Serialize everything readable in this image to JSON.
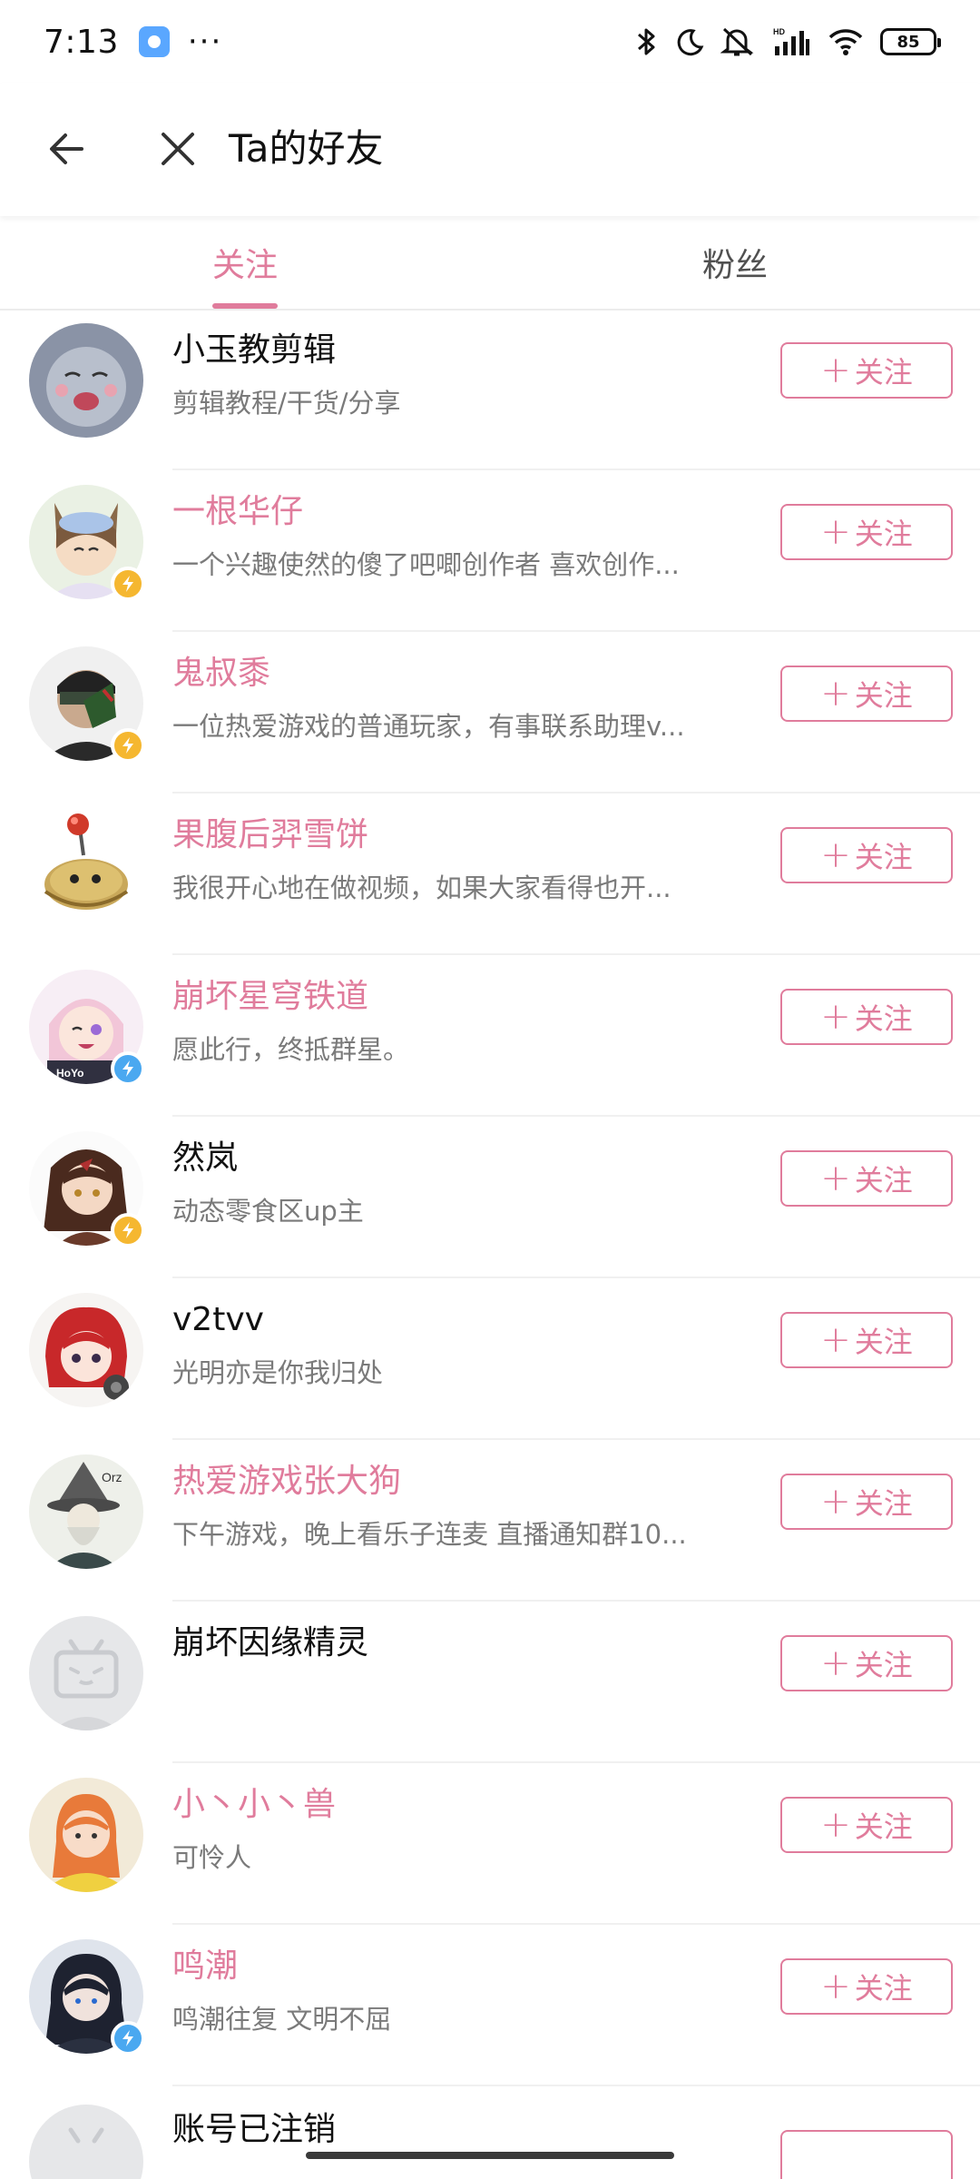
{
  "status_bar": {
    "time": "7:13",
    "more": "···",
    "battery": "85"
  },
  "header": {
    "title": "Ta的好友"
  },
  "tabs": [
    {
      "label": "关注",
      "active": true
    },
    {
      "label": "粉丝",
      "active": false
    }
  ],
  "follow_label": "关注",
  "users": [
    {
      "name": "小玉教剪辑",
      "desc": "剪辑教程/干货/分享",
      "vip": false,
      "badge": null
    },
    {
      "name": "一根华仔",
      "desc": "一个兴趣使然的傻了吧唧创作者 喜欢创作...",
      "vip": true,
      "badge": "yellow"
    },
    {
      "name": "鬼叔黍",
      "desc": "一位热爱游戏的普通玩家，有事联系助理v...",
      "vip": true,
      "badge": "yellow"
    },
    {
      "name": "果腹后羿雪饼",
      "desc": "我很开心地在做视频，如果大家看得也开...",
      "vip": true,
      "badge": null
    },
    {
      "name": "崩坏星穹铁道",
      "desc": "愿此行，终抵群星。",
      "vip": true,
      "badge": "blue"
    },
    {
      "name": "然岚",
      "desc": "动态零食区up主",
      "vip": false,
      "badge": "yellow"
    },
    {
      "name": "v2tvv",
      "desc": "光明亦是你我归处",
      "vip": false,
      "badge": null
    },
    {
      "name": "热爱游戏张大狗",
      "desc": "下午游戏，晚上看乐子连麦 直播通知群10...",
      "vip": true,
      "badge": null
    },
    {
      "name": "崩坏因缘精灵",
      "desc": "",
      "vip": false,
      "badge": null
    },
    {
      "name": "小丶小丶兽",
      "desc": "可怜人",
      "vip": true,
      "badge": null
    },
    {
      "name": "鸣潮",
      "desc": "鸣潮往复 文明不屈",
      "vip": true,
      "badge": "blue"
    }
  ],
  "partial_user": {
    "name": "账号已注销"
  },
  "colors": {
    "accent": "#e07c9c",
    "badge_yellow": "#f5b730",
    "badge_blue": "#4aa8f0"
  }
}
